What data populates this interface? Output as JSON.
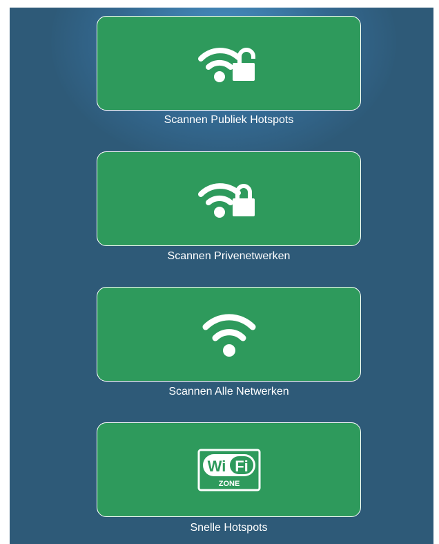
{
  "colors": {
    "background": "#2e5a78",
    "glow": "#4a96cd",
    "card": "#2e9a5c",
    "card_border": "#ffffff",
    "text": "#ffffff"
  },
  "options": [
    {
      "label": "Scannen Publiek Hotspots",
      "icon": "wifi-unlocked-icon"
    },
    {
      "label": "Scannen Privenetwerken",
      "icon": "wifi-locked-icon"
    },
    {
      "label": "Scannen Alle Netwerken",
      "icon": "wifi-icon"
    },
    {
      "label": "Snelle Hotspots",
      "icon": "wifi-zone-icon"
    }
  ],
  "wifi_zone_badge": {
    "wi": "Wi",
    "fi": "Fi",
    "zone": "ZONE"
  }
}
